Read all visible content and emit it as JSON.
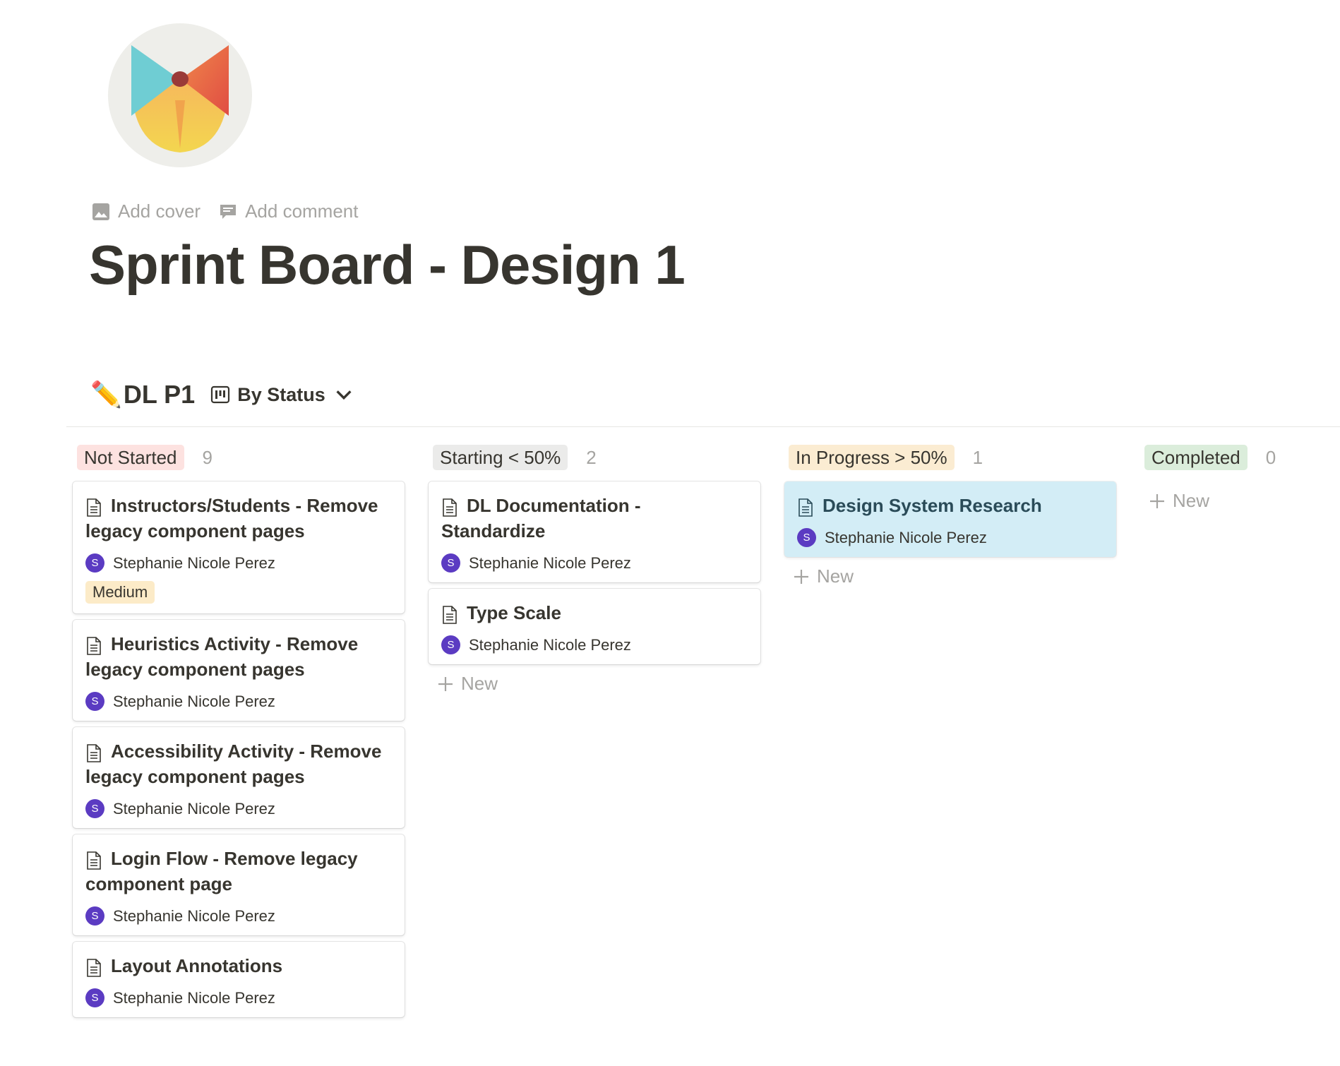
{
  "page": {
    "logo_icon": "bowtie-logo",
    "add_cover": "Add cover",
    "add_comment": "Add comment",
    "title": "Sprint Board - Design 1"
  },
  "database": {
    "emoji": "✏️",
    "title": "DL P1",
    "view_icon": "board-view-icon",
    "view_label": "By Status"
  },
  "columns": [
    {
      "status": "Not Started",
      "count": "9",
      "color": "#fde2e0",
      "cards": [
        {
          "title": "Instructors/Students - Remove legacy component pages",
          "avatar": "S",
          "assignee": "Stephanie Nicole Perez",
          "tag": "Medium"
        },
        {
          "title": "Heuristics Activity - Remove legacy component pages",
          "avatar": "S",
          "assignee": "Stephanie Nicole Perez"
        },
        {
          "title": "Accessibility Activity - Remove legacy component pages",
          "avatar": "S",
          "assignee": "Stephanie Nicole Perez"
        },
        {
          "title": "Login Flow - Remove legacy component page",
          "avatar": "S",
          "assignee": "Stephanie Nicole Perez"
        },
        {
          "title": "Layout Annotations",
          "avatar": "S",
          "assignee": "Stephanie Nicole Perez"
        }
      ]
    },
    {
      "status": "Starting < 50%",
      "count": "2",
      "color": "#ebebea",
      "cards": [
        {
          "title": "DL Documentation - Standardize",
          "avatar": "S",
          "assignee": "Stephanie Nicole Perez"
        },
        {
          "title": "Type Scale",
          "avatar": "S",
          "assignee": "Stephanie Nicole Perez"
        }
      ],
      "new_label": "New"
    },
    {
      "status": "In Progress > 50%",
      "count": "1",
      "color": "#fbecd2",
      "cards": [
        {
          "title": "Design System Research",
          "avatar": "S",
          "assignee": "Stephanie Nicole Perez"
        }
      ],
      "new_label": "New"
    },
    {
      "status": "Completed",
      "count": "0",
      "color": "#dbeddb",
      "cards": [],
      "new_label": "New"
    }
  ],
  "colors": {
    "avatar": "#5b3bc2",
    "highlight_card": "#d3edf6",
    "medium_tag": "#fcebc8"
  }
}
